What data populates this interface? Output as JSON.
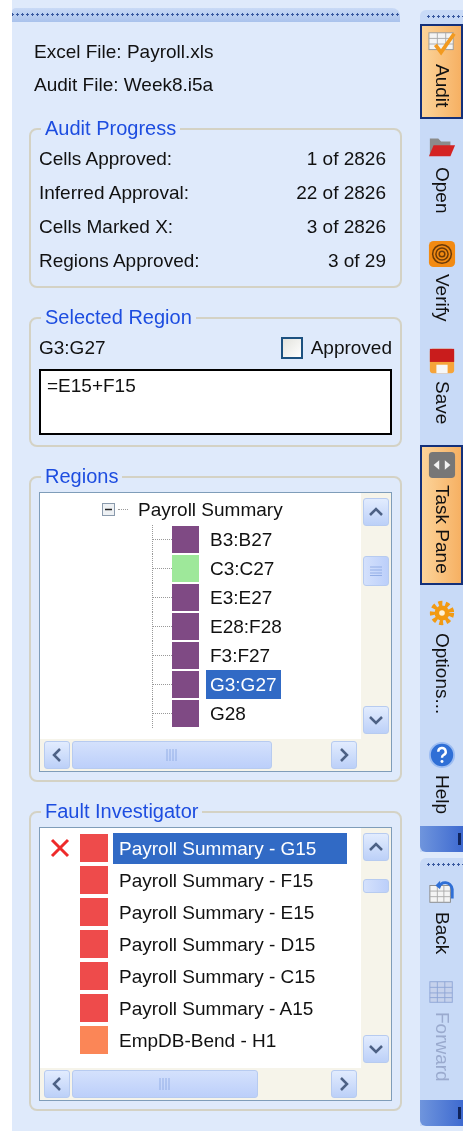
{
  "files": [
    "Excel File: Payroll.xls",
    "Audit File: Week8.i5a"
  ],
  "audit_progress": {
    "title": "Audit Progress",
    "rows": [
      {
        "label": "Cells Approved:",
        "value": "1 of 2826"
      },
      {
        "label": "Inferred Approval:",
        "value": "22 of 2826"
      },
      {
        "label": "Cells Marked X:",
        "value": "3 of 2826"
      },
      {
        "label": "Regions Approved:",
        "value": "3 of 29"
      }
    ]
  },
  "selected_region": {
    "title": "Selected Region",
    "range": "G3:G27",
    "approved_label": "Approved",
    "approved": false,
    "formula": "=E15+F15"
  },
  "regions": {
    "title": "Regions",
    "root": {
      "label": "Payroll Summary",
      "expanded": true,
      "children": [
        {
          "label": "B3:B27",
          "color": "#7f4a84",
          "selected": false
        },
        {
          "label": "C3:C27",
          "color": "#9ee89a",
          "selected": false
        },
        {
          "label": "E3:E27",
          "color": "#7f4a84",
          "selected": false
        },
        {
          "label": "E28:F28",
          "color": "#7f4a84",
          "selected": false
        },
        {
          "label": "F3:F27",
          "color": "#7f4a84",
          "selected": false
        },
        {
          "label": "G3:G27",
          "color": "#7f4a84",
          "selected": true
        },
        {
          "label": "G28",
          "color": "#7f4a84",
          "selected": false
        }
      ]
    }
  },
  "fault_investigator": {
    "title": "Fault Investigator",
    "items": [
      {
        "label": "Payroll Summary - G15",
        "color": "#ee4b4b",
        "marked_x": true,
        "selected": true
      },
      {
        "label": "Payroll Summary - F15",
        "color": "#ee4b4b",
        "marked_x": false,
        "selected": false
      },
      {
        "label": "Payroll Summary - E15",
        "color": "#ee4b4b",
        "marked_x": false,
        "selected": false
      },
      {
        "label": "Payroll Summary - D15",
        "color": "#ee4b4b",
        "marked_x": false,
        "selected": false
      },
      {
        "label": "Payroll Summary - C15",
        "color": "#ee4b4b",
        "marked_x": false,
        "selected": false
      },
      {
        "label": "Payroll Summary - A15",
        "color": "#ee4b4b",
        "marked_x": false,
        "selected": false
      },
      {
        "label": "EmpDB-Bend - H1",
        "color": "#fb8657",
        "marked_x": false,
        "selected": false
      }
    ]
  },
  "toolbar": {
    "groups": [
      [
        {
          "label": "Audit",
          "kind": "audit",
          "selected": true,
          "disabled": false
        },
        {
          "label": "Open",
          "kind": "open",
          "selected": false,
          "disabled": false
        },
        {
          "label": "Verify",
          "kind": "verify",
          "selected": false,
          "disabled": false
        },
        {
          "label": "Save",
          "kind": "save",
          "selected": false,
          "disabled": false
        },
        {
          "label": "Task Pane",
          "kind": "taskpane",
          "selected": true,
          "disabled": false
        },
        {
          "label": "Options...",
          "kind": "options",
          "selected": false,
          "disabled": false
        },
        {
          "label": "Help",
          "kind": "help",
          "selected": false,
          "disabled": false
        }
      ],
      [
        {
          "label": "Back",
          "kind": "back",
          "selected": false,
          "disabled": false
        },
        {
          "label": "Forward",
          "kind": "forward",
          "selected": false,
          "disabled": true
        }
      ]
    ]
  }
}
